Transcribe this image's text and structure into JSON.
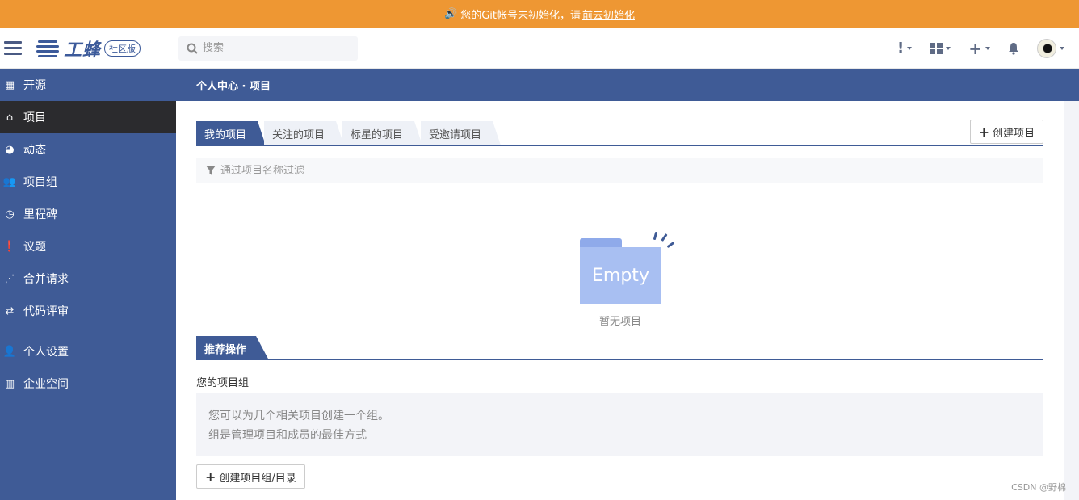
{
  "banner": {
    "text": "您的Git帐号未初始化，请",
    "link": "前去初始化",
    "icon": "speaker-icon"
  },
  "header": {
    "logo_text": "工蜂",
    "logo_badge": "社区版",
    "search_placeholder": "搜索",
    "icons": [
      "alert-icon",
      "apps-grid-icon",
      "plus-icon",
      "bell-icon",
      "avatar"
    ]
  },
  "sidebar": {
    "items": [
      {
        "label": "开源",
        "icon": "map-icon"
      },
      {
        "label": "项目",
        "icon": "home-icon",
        "active": true
      },
      {
        "label": "动态",
        "icon": "dashboard-icon"
      },
      {
        "label": "项目组",
        "icon": "users-icon"
      },
      {
        "label": "里程碑",
        "icon": "clock-icon"
      },
      {
        "label": "议题",
        "icon": "exclamation-icon"
      },
      {
        "label": "合并请求",
        "icon": "merge-icon"
      },
      {
        "label": "代码评审",
        "icon": "code-review-icon"
      },
      {
        "label": "个人设置",
        "icon": "user-icon"
      },
      {
        "label": "企业空间",
        "icon": "building-icon"
      }
    ]
  },
  "breadcrumb": "个人中心 · 项目",
  "tabs": [
    "我的项目",
    "关注的项目",
    "标星的项目",
    "受邀请项目"
  ],
  "create_project_label": "创建项目",
  "filter_placeholder": "通过项目名称过滤",
  "empty": {
    "image_text": "Empty",
    "caption": "暂无项目"
  },
  "recommend": {
    "title": "推荐操作",
    "group_label": "您的项目组",
    "line1": "您可以为几个相关项目创建一个组。",
    "line2": "组是管理项目和成员的最佳方式",
    "create_group_label": "创建项目组/目录"
  },
  "watermark": "CSDN @野棉",
  "colors": {
    "banner": "#ee9733",
    "primary": "#3f5b96",
    "sidebar_active": "#2b2b2e"
  }
}
